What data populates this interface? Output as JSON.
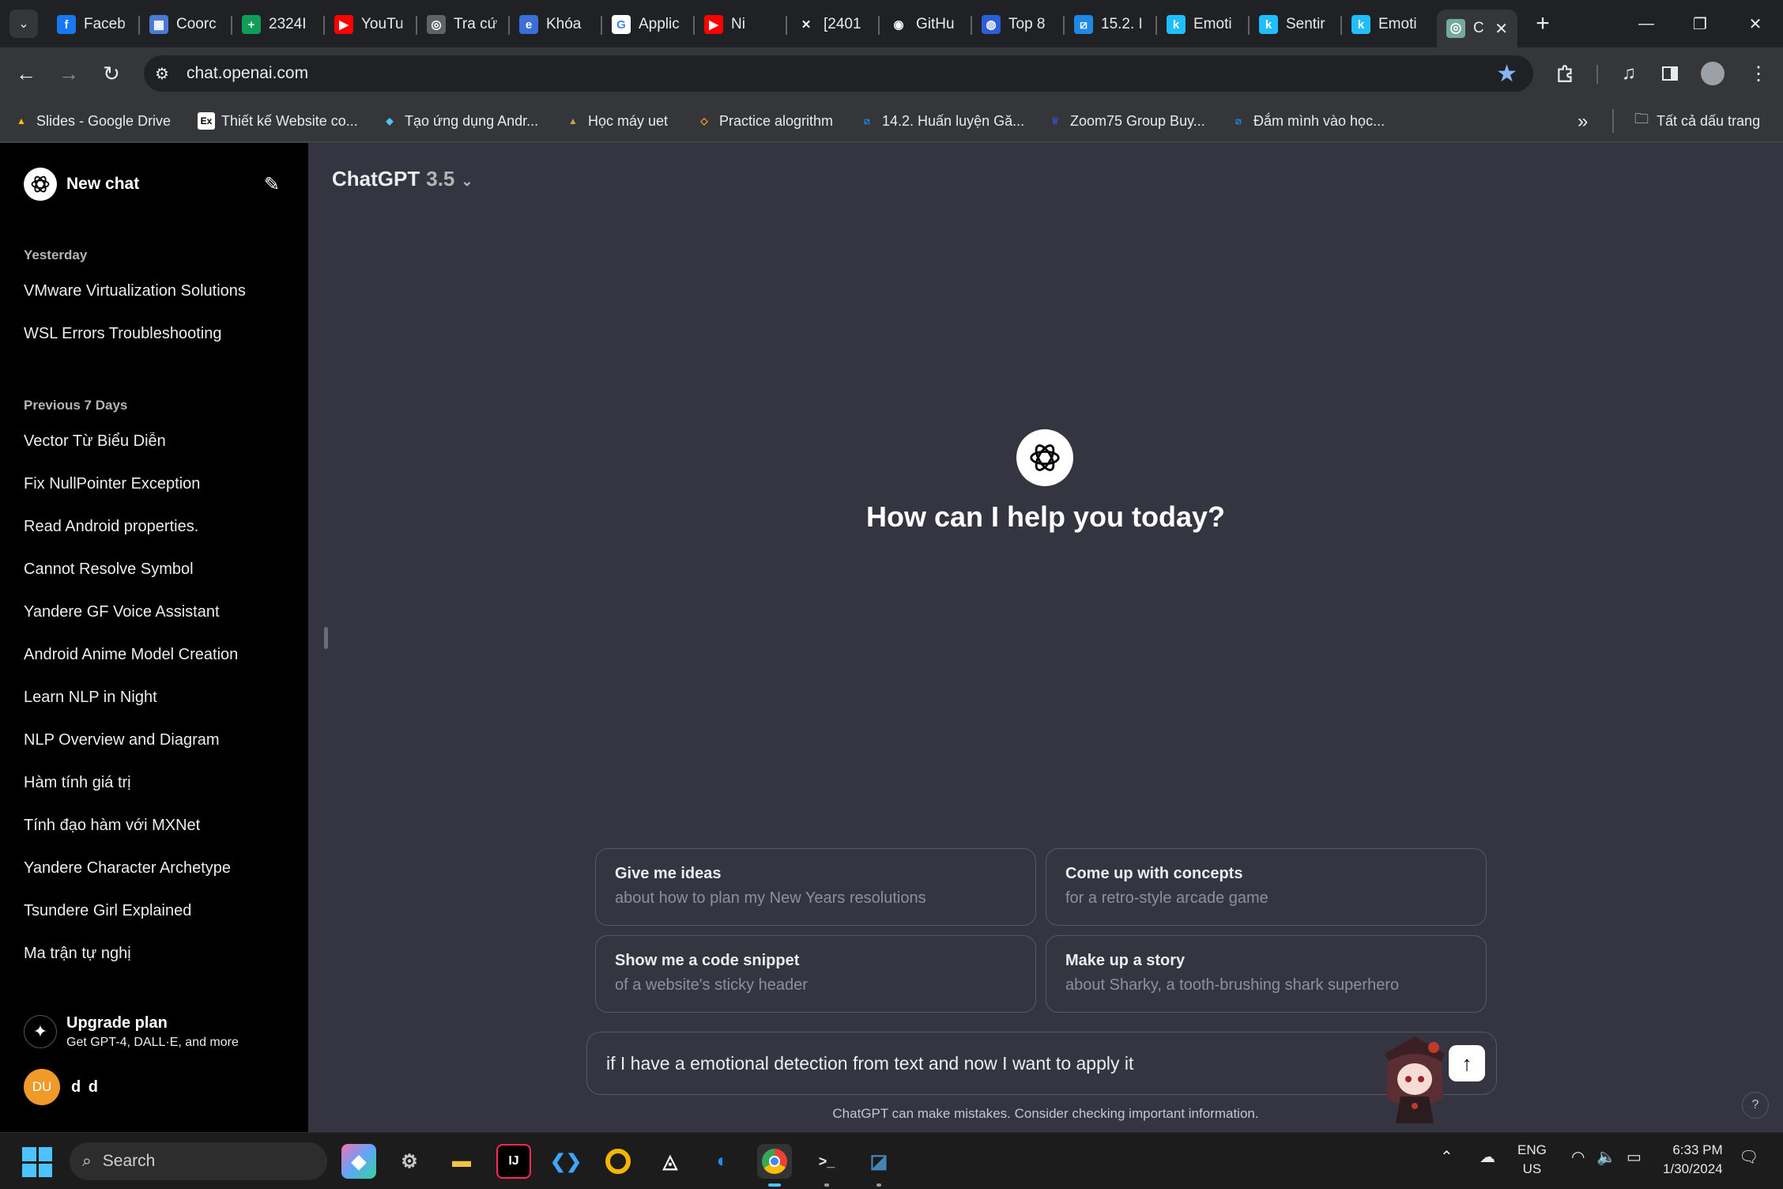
{
  "browser": {
    "tabs": [
      {
        "label": "Faceb",
        "icon": "facebook-icon",
        "color": "#1877f2",
        "glyph": "f"
      },
      {
        "label": "Coorc",
        "icon": "coordinator-icon",
        "color": "#4a7bd4",
        "glyph": "▦"
      },
      {
        "label": "2324I",
        "icon": "sheets-icon",
        "color": "#0f9d58",
        "glyph": "+"
      },
      {
        "label": "YouTu",
        "icon": "youtube-icon",
        "color": "#ff0000",
        "glyph": "▶"
      },
      {
        "label": "Tra cứ",
        "icon": "globe-icon",
        "color": "#5f6368",
        "glyph": "◎"
      },
      {
        "label": "Khóa",
        "icon": "course-icon",
        "color": "#3a6fd8",
        "glyph": "e"
      },
      {
        "label": "Applic",
        "icon": "google-icon",
        "color": "#ffffff",
        "glyph": "G"
      },
      {
        "label": "Ni",
        "icon": "youtube-icon",
        "color": "#ff0000",
        "glyph": "▶"
      },
      {
        "label": "[2401",
        "icon": "arxiv-icon",
        "color": "#202124",
        "glyph": "✕"
      },
      {
        "label": "GitHu",
        "icon": "github-icon",
        "color": "#202124",
        "glyph": "◉"
      },
      {
        "label": "Top 8",
        "icon": "site-icon",
        "color": "#2b5fd9",
        "glyph": "◍"
      },
      {
        "label": "15.2. I",
        "icon": "d2l-icon",
        "color": "#1e88e5",
        "glyph": "⧄"
      },
      {
        "label": "Emoti",
        "icon": "kaggle-icon",
        "color": "#20beff",
        "glyph": "k"
      },
      {
        "label": "Sentir",
        "icon": "kaggle-icon",
        "color": "#20beff",
        "glyph": "k"
      },
      {
        "label": "Emoti",
        "icon": "kaggle-icon",
        "color": "#20beff",
        "glyph": "k"
      }
    ],
    "active_tab": {
      "label": "C",
      "icon": "chatgpt-icon"
    },
    "url": "chat.openai.com",
    "bookmarks": [
      {
        "label": "Slides - Google Drive",
        "icon": "drive-icon",
        "color": "#fbbc04",
        "glyph": "▲"
      },
      {
        "label": "Thiết kế Website co...",
        "icon": "ex-icon",
        "color": "#ffffff",
        "glyph": "Ex"
      },
      {
        "label": "Tạo ứng dụng Andr...",
        "icon": "android-icon",
        "color": "#4fc3f7",
        "glyph": "◆"
      },
      {
        "label": "Học máy uet",
        "icon": "uet-icon",
        "color": "#c9a35a",
        "glyph": "▲"
      },
      {
        "label": "Practice alogrithm",
        "icon": "algo-icon",
        "color": "#ffa116",
        "glyph": "◇"
      },
      {
        "label": "14.2. Huấn luyện Gă...",
        "icon": "d2l-icon",
        "color": "#1e88e5",
        "glyph": "⧄"
      },
      {
        "label": "Zoom75 Group Buy...",
        "icon": "zoom-icon",
        "color": "#3949ab",
        "glyph": "♛"
      },
      {
        "label": "Đắm mình vào học...",
        "icon": "d2l-icon",
        "color": "#1e88e5",
        "glyph": "⧄"
      }
    ],
    "all_bookmarks_label": "Tất cả dấu trang"
  },
  "sidebar": {
    "new_chat_label": "New chat",
    "sections": [
      {
        "heading": "Yesterday",
        "items": [
          "VMware Virtualization Solutions",
          "WSL Errors Troubleshooting"
        ]
      },
      {
        "heading": "Previous 7 Days",
        "items": [
          "Vector Từ Biểu Diễn",
          "Fix NullPointer Exception",
          "Read Android properties.",
          "Cannot Resolve Symbol",
          "Yandere GF Voice Assistant",
          "Android Anime Model Creation",
          "Learn NLP in Night",
          "NLP Overview and Diagram",
          "Hàm tính giá trị",
          "Tính đạo hàm với MXNet",
          "Yandere Character Archetype",
          "Tsundere Girl Explained",
          "Ma trận tự nghị"
        ]
      }
    ],
    "upgrade": {
      "title": "Upgrade plan",
      "subtitle": "Get GPT-4, DALL·E, and more"
    },
    "user": {
      "initials": "DU",
      "name": "d d"
    }
  },
  "main": {
    "model_name": "ChatGPT",
    "model_version": "3.5",
    "hero_title": "How can I help you today?",
    "suggestions": [
      {
        "title": "Give me ideas",
        "subtitle": "about how to plan my New Years resolutions"
      },
      {
        "title": "Come up with concepts",
        "subtitle": "for a retro-style arcade game"
      },
      {
        "title": "Show me a code snippet",
        "subtitle": "of a website's sticky header"
      },
      {
        "title": "Make up a story",
        "subtitle": "about Sharky, a tooth-brushing shark superhero"
      }
    ],
    "composer_value": "if I have a emotional detection from text and now I want to apply it",
    "disclaimer": "ChatGPT can make mistakes. Consider checking important information.",
    "help_label": "?"
  },
  "taskbar": {
    "search_label": "Search",
    "language": "ENG",
    "region": "US",
    "time": "6:33 PM",
    "date": "1/30/2024"
  },
  "colors": {
    "accent": "#10a37f",
    "main_bg": "#343541",
    "sidebar_bg": "#000000",
    "avatar": "#f09a2a"
  }
}
